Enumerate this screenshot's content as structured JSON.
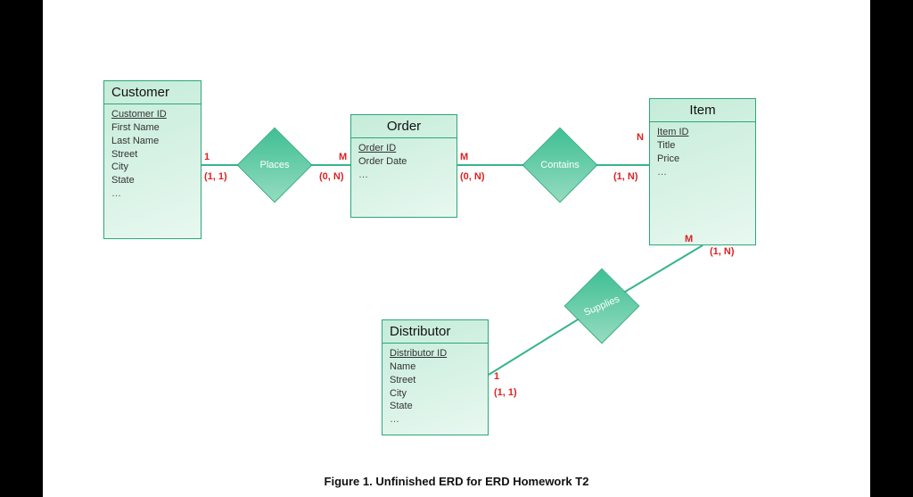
{
  "caption": {
    "label": "Figure 1.",
    "text": "Unfinished ERD for ERD Homework T2"
  },
  "entities": {
    "customer": {
      "title": "Customer",
      "pk": "Customer ID",
      "attrs": [
        "First Name",
        "Last Name",
        "Street",
        "City",
        "State"
      ],
      "more": "…"
    },
    "order": {
      "title": "Order",
      "pk": "Order ID",
      "attrs": [
        "Order Date"
      ],
      "more": "…"
    },
    "item": {
      "title": "Item",
      "pk": "Item ID",
      "attrs": [
        "Title",
        "Price"
      ],
      "more": "…"
    },
    "distributor": {
      "title": "Distributor",
      "pk": "Distributor ID",
      "attrs": [
        "Name",
        "Street",
        "City",
        "State"
      ],
      "more": "…"
    }
  },
  "relationships": {
    "places": {
      "label": "Places"
    },
    "contains": {
      "label": "Contains"
    },
    "supplies": {
      "label": "Supplies"
    }
  },
  "cardinalities": {
    "cust_out_n": "1",
    "cust_out_p": "(1, 1)",
    "order_left_n": "M",
    "order_left_p": "(0, N)",
    "order_right_n": "M",
    "order_right_p": "(0, N)",
    "item_left_n": "N",
    "item_left_p": "(1, N)",
    "item_bottom_n": "M",
    "item_bottom_p": "(1, N)",
    "dist_right_n": "1",
    "dist_right_p": "(1, 1)"
  }
}
